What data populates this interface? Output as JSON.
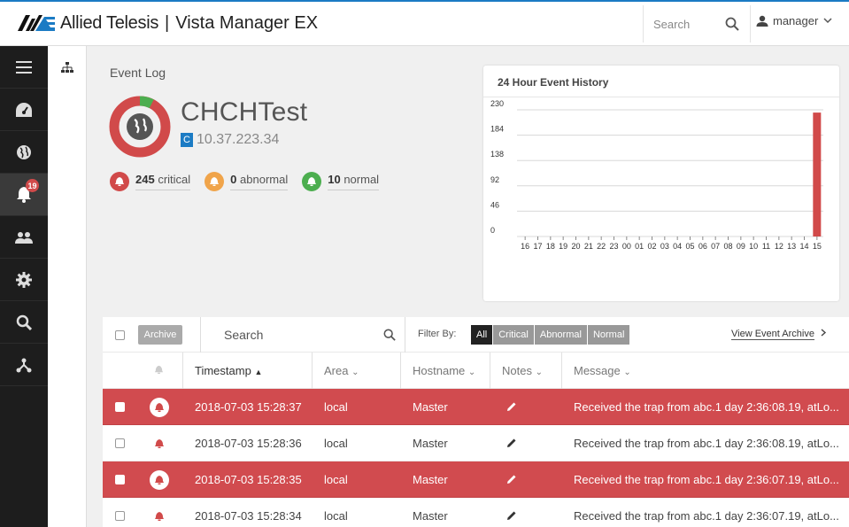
{
  "header": {
    "brand": "Allied Telesis",
    "separator": "|",
    "app_name": "Vista Manager EX",
    "search_placeholder": "Search",
    "user": "manager"
  },
  "nav": {
    "items": [
      {
        "icon": "menu-icon"
      },
      {
        "icon": "dashboard-icon"
      },
      {
        "icon": "globe-icon"
      },
      {
        "icon": "bell-icon",
        "badge": "19",
        "active": true
      },
      {
        "icon": "users-icon"
      },
      {
        "icon": "gear-icon"
      },
      {
        "icon": "search-icon"
      },
      {
        "icon": "topology-icon"
      }
    ],
    "subnav_icon": "sitemap-icon"
  },
  "device": {
    "panel_title": "Event Log",
    "name": "CHCHTest",
    "ip_flag": "C",
    "ip": "10.37.223.34",
    "counts": [
      {
        "num": "245",
        "label": "critical",
        "color": "#d14a4a"
      },
      {
        "num": "0",
        "label": "abnormal",
        "color": "#f0a44a"
      },
      {
        "num": "10",
        "label": "normal",
        "color": "#4cae4f"
      }
    ],
    "donut_colors": {
      "critical": "#d14a4a",
      "normal": "#4cae4f"
    }
  },
  "chart_data": {
    "type": "bar",
    "title": "24 Hour Event History",
    "categories": [
      "16",
      "17",
      "18",
      "19",
      "20",
      "21",
      "22",
      "23",
      "00",
      "01",
      "02",
      "03",
      "04",
      "05",
      "06",
      "07",
      "08",
      "09",
      "10",
      "11",
      "12",
      "13",
      "14",
      "15"
    ],
    "values": [
      0,
      0,
      0,
      0,
      0,
      0,
      0,
      0,
      0,
      0,
      0,
      0,
      0,
      0,
      0,
      0,
      0,
      0,
      0,
      0,
      0,
      0,
      0,
      225
    ],
    "yticks": [
      0,
      46,
      92,
      138,
      184,
      230
    ],
    "ylim": [
      0,
      230
    ],
    "color": "#d14a4a",
    "grid": true
  },
  "toolbar": {
    "archive_label": "Archive",
    "search_placeholder": "Search",
    "filter_label": "Filter By:",
    "filters": [
      "All",
      "Critical",
      "Abnormal",
      "Normal"
    ],
    "view_archive": "View Event Archive"
  },
  "table": {
    "columns": {
      "timestamp": "Timestamp",
      "area": "Area",
      "hostname": "Hostname",
      "notes": "Notes",
      "message": "Message"
    },
    "rows": [
      {
        "critical": true,
        "timestamp": "2018-07-03 15:28:37",
        "area": "local",
        "hostname": "Master",
        "message": "Received the trap from abc.1 day 2:36:08.19, atLo..."
      },
      {
        "critical": false,
        "timestamp": "2018-07-03 15:28:36",
        "area": "local",
        "hostname": "Master",
        "message": "Received the trap from abc.1 day 2:36:08.19, atLo..."
      },
      {
        "critical": true,
        "timestamp": "2018-07-03 15:28:35",
        "area": "local",
        "hostname": "Master",
        "message": "Received the trap from abc.1 day 2:36:07.19, atLo..."
      },
      {
        "critical": false,
        "timestamp": "2018-07-03 15:28:34",
        "area": "local",
        "hostname": "Master",
        "message": "Received the trap from abc.1 day 2:36:07.19, atLo..."
      }
    ]
  },
  "colors": {
    "accent": "#1b7bc4",
    "critical": "#d14a4a",
    "abnormal": "#f0a44a",
    "normal": "#4cae4f"
  }
}
